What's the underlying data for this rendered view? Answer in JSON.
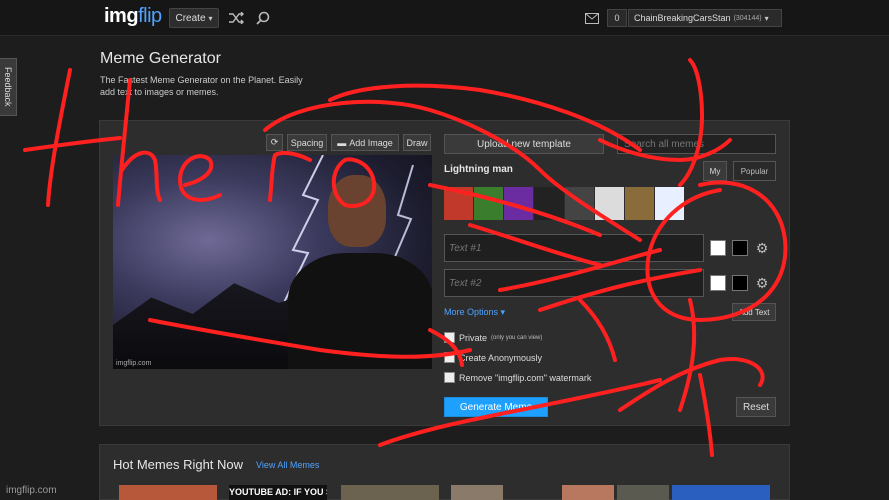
{
  "nav": {
    "logo_img": "img",
    "logo_flip": "flip",
    "create_label": "Create",
    "notif_count": "0",
    "username": "ChainBreakingCarsStan",
    "points": "(304144)"
  },
  "feedback": "Feedback",
  "page": {
    "title": "Meme Generator",
    "subtitle": "The Fastest Meme Generator on the Planet. Easily add text to images or memes."
  },
  "toolbar": {
    "spacing": "Spacing",
    "add_image": "Add Image",
    "draw": "Draw"
  },
  "preview": {
    "watermark": "imgflip.com"
  },
  "sidebar": {
    "upload": "Upload new template",
    "search_placeholder": "Search all memes",
    "template_name": "Lightning man",
    "my": "My",
    "popular": "Popular",
    "thumbnail_colors": [
      "#c0392b",
      "#3a7d2c",
      "#6a2ca0",
      "#222222",
      "#444444",
      "#dcdcdc",
      "#8a6b3a",
      "#e8f0ff"
    ]
  },
  "text_boxes": [
    {
      "placeholder": "Text #1"
    },
    {
      "placeholder": "Text #2"
    }
  ],
  "options": {
    "more": "More Options",
    "add_text": "Add Text",
    "private": "Private",
    "private_hint": "(only you can view)",
    "anonymous": "Create Anonymously",
    "remove_watermark": "Remove \"imgflip.com\" watermark",
    "generate": "Generate Meme",
    "reset": "Reset"
  },
  "hot": {
    "title": "Hot Memes Right Now",
    "view_all": "View All Memes",
    "caption": "YOUTUBE AD: IF YOU SKIP",
    "thumb_colors": [
      "#b8583a",
      "#111111",
      "#6b6350",
      "#8a7a6a",
      "#b87860",
      "#5a5a50",
      "#2b5fbf"
    ]
  },
  "footer_watermark": "imgflip.com",
  "colors": {
    "accent": "#1ea0ff",
    "scribble": "#ff2020"
  }
}
